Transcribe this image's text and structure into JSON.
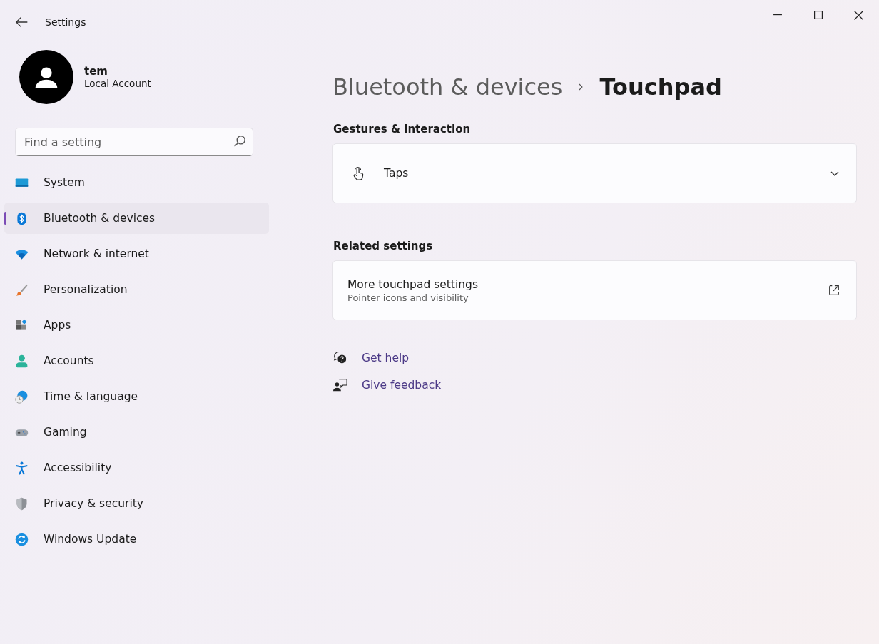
{
  "window": {
    "title": "Settings"
  },
  "account": {
    "name": "tem",
    "type": "Local Account"
  },
  "search": {
    "placeholder": "Find a setting"
  },
  "nav": [
    {
      "label": "System",
      "selected": false
    },
    {
      "label": "Bluetooth & devices",
      "selected": true
    },
    {
      "label": "Network & internet",
      "selected": false
    },
    {
      "label": "Personalization",
      "selected": false
    },
    {
      "label": "Apps",
      "selected": false
    },
    {
      "label": "Accounts",
      "selected": false
    },
    {
      "label": "Time & language",
      "selected": false
    },
    {
      "label": "Gaming",
      "selected": false
    },
    {
      "label": "Accessibility",
      "selected": false
    },
    {
      "label": "Privacy & security",
      "selected": false
    },
    {
      "label": "Windows Update",
      "selected": false
    }
  ],
  "breadcrumb": {
    "parent": "Bluetooth & devices",
    "current": "Touchpad"
  },
  "sections": [
    {
      "title": "Gestures & interaction",
      "cards": [
        {
          "kind": "expander",
          "title": "Taps",
          "expanded": false
        }
      ]
    },
    {
      "title": "Related settings",
      "cards": [
        {
          "kind": "link",
          "title": "More touchpad settings",
          "subtitle": "Pointer icons and visibility"
        }
      ]
    }
  ],
  "help_links": [
    "Get help",
    "Give feedback"
  ]
}
